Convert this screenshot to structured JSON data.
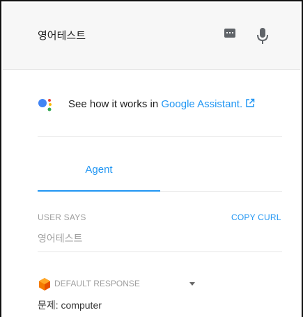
{
  "header": {
    "title": "영어테스트",
    "keyboard_icon": "keyboard-icon",
    "mic_icon": "microphone-icon"
  },
  "assistant": {
    "prefix": "See how it works in ",
    "link_text": "Google Assistant.",
    "logo_icon": "google-assistant-logo",
    "link_icon": "external-link-icon"
  },
  "tabs": [
    {
      "label": "Agent"
    }
  ],
  "request": {
    "user_says_label": "USER SAYS",
    "copy_curl_label": "COPY CURL",
    "query": "영어테스트"
  },
  "response": {
    "label": "DEFAULT RESPONSE",
    "text": "문제: computer",
    "icon": "cube-icon"
  },
  "colors": {
    "accent": "#2196f3",
    "header_bg": "#f7f7f7",
    "muted": "#9e9e9e",
    "cube": "#f57c00"
  }
}
